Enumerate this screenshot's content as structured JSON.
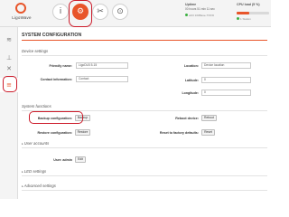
{
  "brand": {
    "name": "LigoWave",
    "accent": "#e8552a",
    "highlight": "#cc1c2b"
  },
  "header": {
    "buttons": [
      {
        "icon": "info-icon",
        "glyph": "i"
      },
      {
        "icon": "gear-icon",
        "glyph": "⚙"
      },
      {
        "icon": "tools-icon",
        "glyph": "✂"
      },
      {
        "icon": "camera-icon",
        "glyph": "⊙"
      }
    ],
    "uptime": {
      "title": "Uptime",
      "value": "00 hours 51 min  11 sec",
      "status": "eth0 100Base-TX/FD"
    },
    "cpu": {
      "title": "CPU load (5 %)",
      "value": "",
      "status": "1 Station"
    }
  },
  "sidebar": {
    "items": [
      {
        "icon": "wireless-icon",
        "glyph": "≋"
      },
      {
        "icon": "network-icon",
        "glyph": "⊥"
      },
      {
        "icon": "services-icon",
        "glyph": "✕"
      },
      {
        "icon": "system-icon",
        "glyph": "≡"
      }
    ]
  },
  "page": {
    "title": "SYSTEM CONFIGURATION",
    "device_settings": {
      "heading": "Device settings",
      "friendly_name_label": "Friendly name:",
      "friendly_name_value": "LigoDLB 5-15",
      "contact_label": "Contact information:",
      "contact_value": "Contact",
      "location_label": "Location:",
      "location_value": "Device location",
      "latitude_label": "Latitude:",
      "latitude_value": "0",
      "longitude_label": "Longitude:",
      "longitude_value": "0"
    },
    "system_functions": {
      "heading": "System functions",
      "backup_label": "Backup configuration:",
      "backup_button": "Backup",
      "restore_label": "Restore configuration:",
      "restore_button": "Restore",
      "reboot_label": "Reboot device:",
      "reboot_button": "Reboot",
      "reset_label": "Reset to factory defaults:",
      "reset_button": "Reset"
    },
    "user_accounts": {
      "heading": "User accounts",
      "user_label": "User: admin",
      "edit_button": "Edit"
    },
    "led_settings": {
      "heading": "LED settings"
    },
    "advanced_settings": {
      "heading": "Advanced settings"
    }
  }
}
